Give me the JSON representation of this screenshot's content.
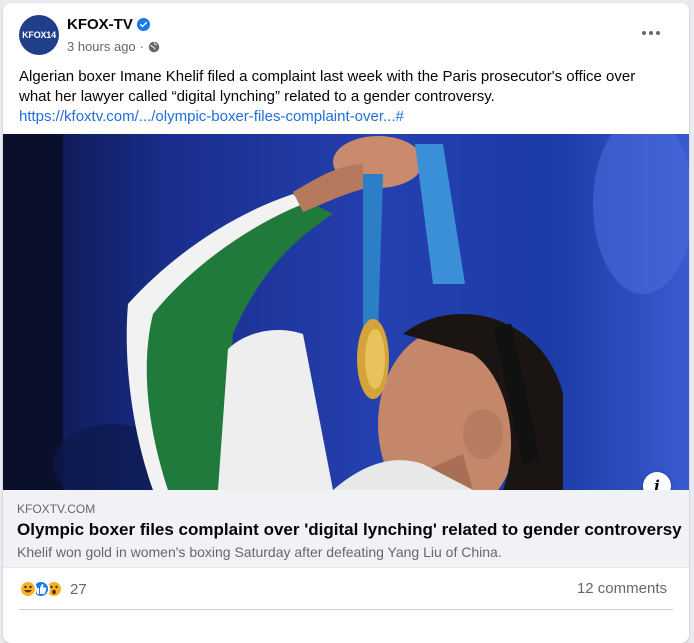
{
  "post": {
    "page_name": "KFOX-TV",
    "avatar_text": "KFOX14",
    "timestamp": "3 hours ago",
    "separator": "·",
    "text": "Algerian boxer Imane Khelif filed a complaint last week with the Paris prosecutor's office over what her lawyer called “digital lynching” related to a gender controversy.",
    "link_text": "https://kfoxtv.com/.../olympic-boxer-files-complaint-over...#",
    "icons": [
      "verified-badge-icon",
      "globe-icon",
      "more-options-icon",
      "info-icon"
    ]
  },
  "preview": {
    "domain": "KFOXTV.COM",
    "headline": "Olympic boxer files complaint over 'digital lynching' related to gender controversy",
    "description": "Khelif won gold in women's boxing Saturday after defeating Yang Liu of China."
  },
  "engagement": {
    "reaction_icons": [
      "haha-icon",
      "like-icon",
      "wow-icon"
    ],
    "reaction_count": "27",
    "comments": "12 comments"
  },
  "colors": {
    "link": "#216fdb",
    "verified": "#1877f2",
    "avatar_bg": "#1f3f8a",
    "preview_bg": "#f0f2f5"
  }
}
